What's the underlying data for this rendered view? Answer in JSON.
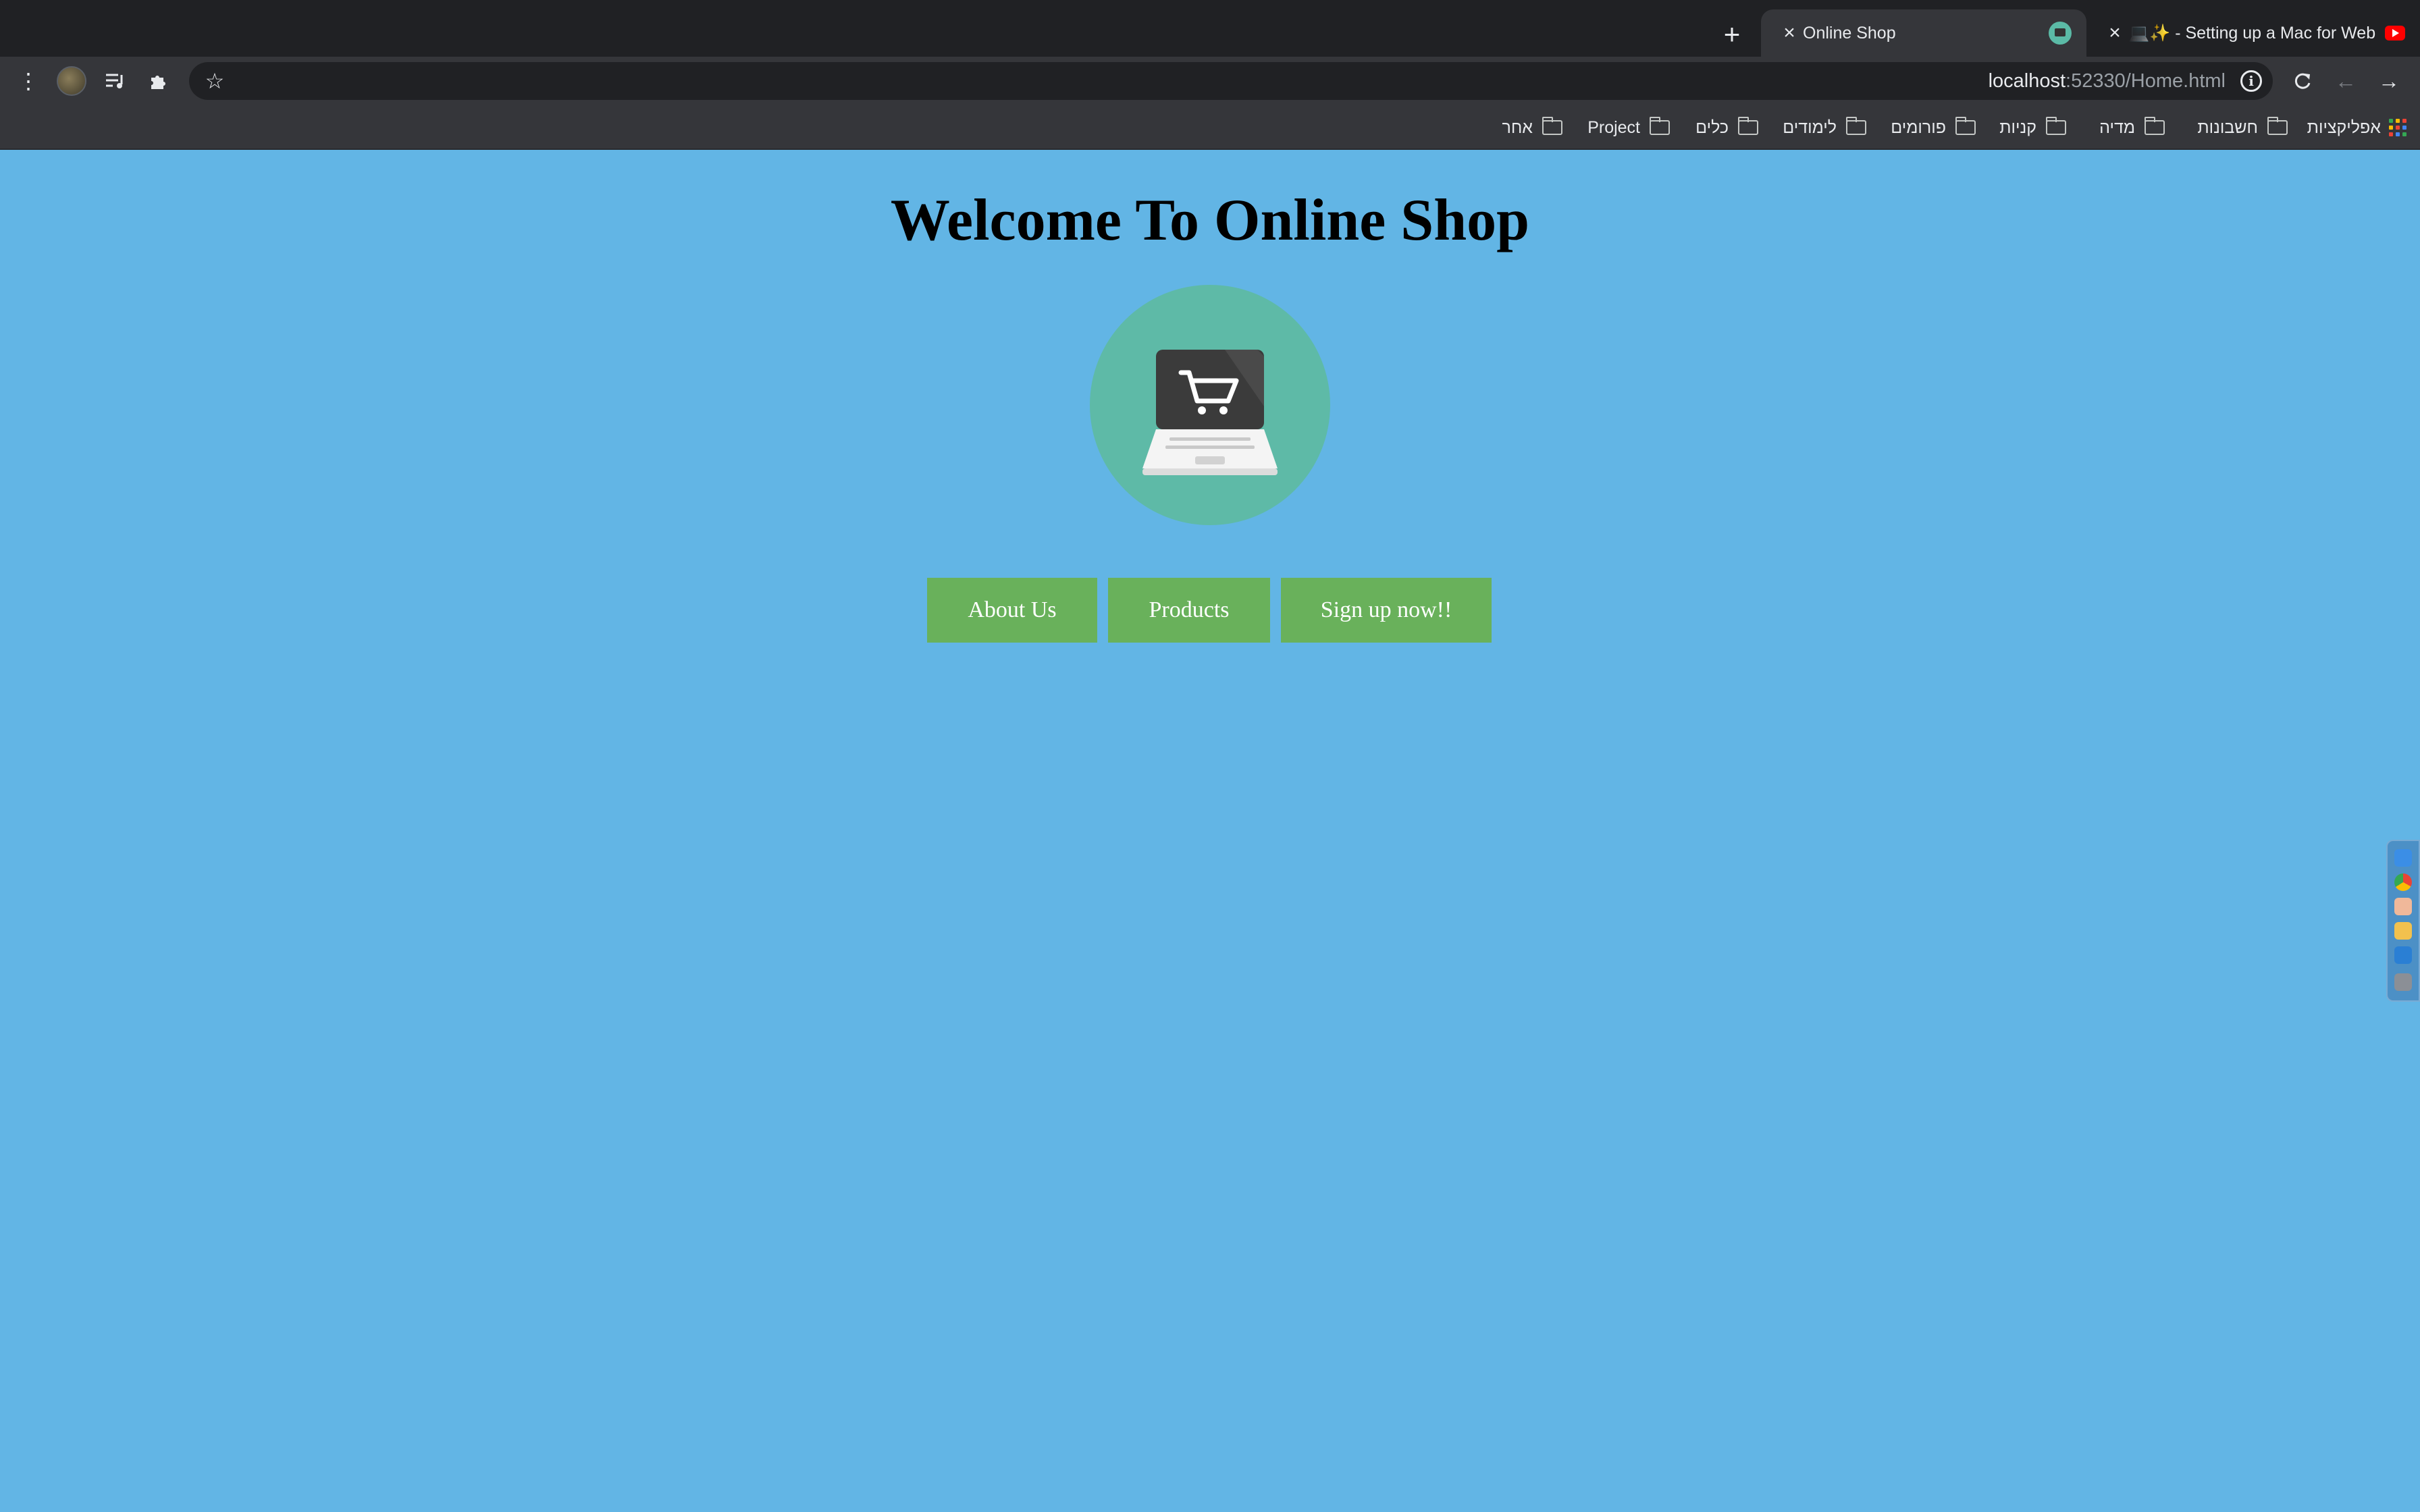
{
  "tabs": [
    {
      "title": "Online Shop",
      "active": true
    },
    {
      "title": "💻✨ - Setting up a Mac for Web Development",
      "active": false
    }
  ],
  "toolbar": {
    "url_host": "localhost",
    "url_path": ":52330/Home.html"
  },
  "bookmarks": {
    "apps_label": "אפליקציות",
    "folders": [
      "חשבונות",
      "מדיה",
      "קניות",
      "פורומים",
      "לימודים",
      "כלים",
      "Project",
      "אחר"
    ]
  },
  "page": {
    "title": "Welcome To Online Shop",
    "buttons": {
      "about": "About Us",
      "products": "Products",
      "signup": "Sign up now!!"
    }
  },
  "colors": {
    "page_background": "#62b5e5",
    "logo_circle": "#5ebaa7",
    "button_green": "#69b15b",
    "chrome_dark": "#202124"
  },
  "icons": {
    "logo": "laptop-shopping-cart-icon"
  }
}
